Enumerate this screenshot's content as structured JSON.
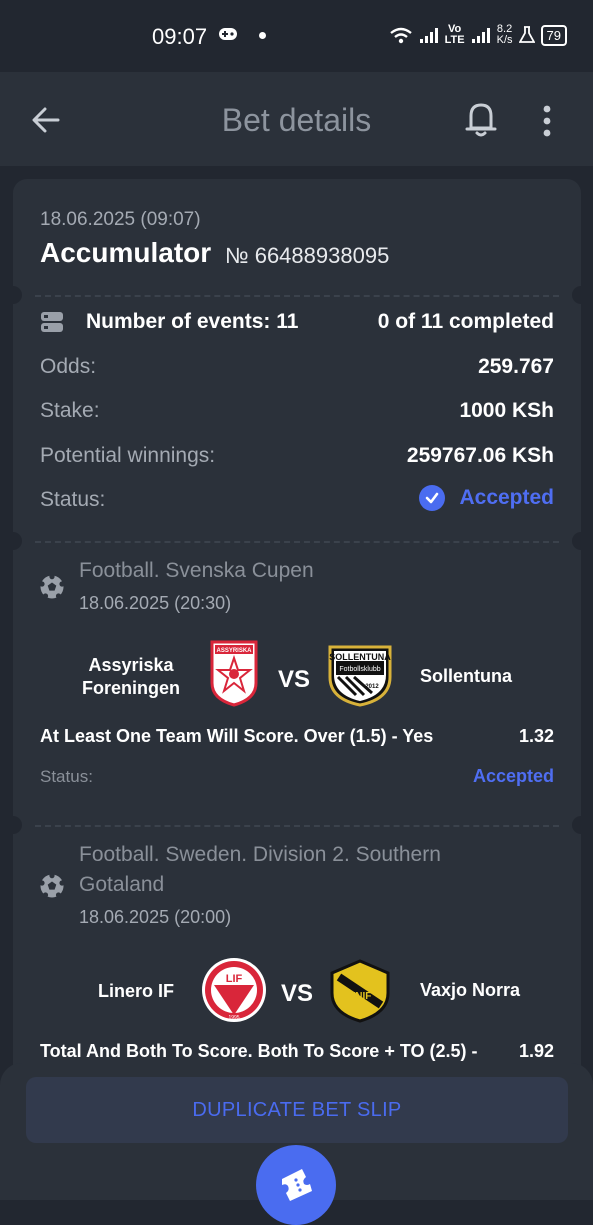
{
  "status_bar": {
    "time": "09:07",
    "network": "Vo\nLTE",
    "speed": "8.2\nK/s",
    "battery": "79"
  },
  "app_bar": {
    "title": "Bet details"
  },
  "bet": {
    "date": "18.06.2025 (09:07)",
    "type": "Accumulator",
    "number": "№ 66488938095",
    "events_label": "Number of events: 11",
    "completed": "0 of 11 completed",
    "odds_label": "Odds:",
    "odds_value": "259.767",
    "stake_label": "Stake:",
    "stake_value": "1000 KSh",
    "winnings_label": "Potential winnings:",
    "winnings_value": "259767.06 KSh",
    "status_label": "Status:",
    "status_value": "Accepted"
  },
  "events": [
    {
      "league": "Football. Svenska Cupen",
      "date": "18.06.2025 (20:30)",
      "home": "Assyriska Foreningen",
      "away": "Sollentuna",
      "vs": "VS",
      "market": "At Least One Team Will Score. Over (1.5) - Yes",
      "odds": "1.32",
      "status_label": "Status:",
      "status": "Accepted"
    },
    {
      "league": "Football. Sweden. Division 2. Southern Gotaland",
      "date": "18.06.2025 (20:00)",
      "home": "Linero IF",
      "away": "Vaxjo Norra",
      "vs": "VS",
      "market": "Total And Both To Score. Both To Score + TO (2.5) -",
      "odds": "1.92"
    }
  ],
  "logos": {
    "assyriska": "ASSYRISKA",
    "sollentuna": "SOLLENTUNA",
    "sollentuna_sub": "Fotbollsklubb",
    "sollentuna_year": "2012",
    "linero": "LIF",
    "linero_year": "1995",
    "vaxjo": "VNIF"
  },
  "actions": {
    "duplicate": "DUPLICATE BET SLIP"
  },
  "icons": [
    "back-arrow-icon",
    "bell-icon",
    "more-vertical-icon",
    "list-icon",
    "check-circle-icon",
    "football-icon",
    "ticket-icon"
  ],
  "colors": {
    "accent": "#4a6cf0",
    "background": "#222730",
    "card": "#2b313a"
  }
}
